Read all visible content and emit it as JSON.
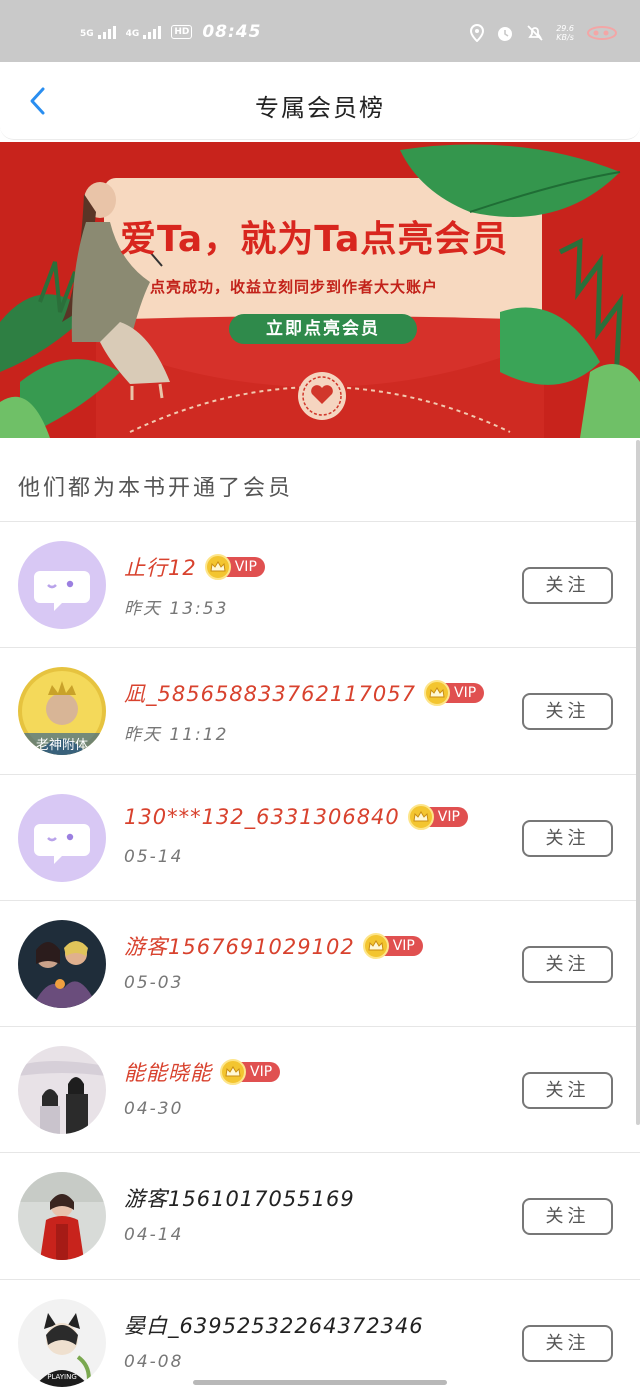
{
  "status_bar": {
    "network1": "5G",
    "network2": "4G",
    "hd": "HD",
    "time": "08:45",
    "speed_value": "29.6",
    "speed_unit": "KB/s"
  },
  "header": {
    "title": "专属会员榜"
  },
  "banner": {
    "headline": "爱Ta，就为Ta点亮会员",
    "subtitle": "点亮成功，收益立刻同步到作者大大账户",
    "cta": "立即点亮会员"
  },
  "section": {
    "heading": "他们都为本书开通了会员"
  },
  "members": [
    {
      "name": "止行12",
      "date": "昨天 13:53",
      "vip": true,
      "avatar": "default-chat-avatar",
      "follow": "关注"
    },
    {
      "name": "凪_5856588337621170​57",
      "date": "昨天 11:12",
      "vip": true,
      "avatar": "photo-avatar-crown",
      "follow": "关注"
    },
    {
      "name": "130***132_6331306840",
      "date": "05-14",
      "vip": true,
      "avatar": "default-chat-avatar",
      "follow": "关注"
    },
    {
      "name": "游客1567691029102",
      "date": "05-03",
      "vip": true,
      "avatar": "photo-avatar-anime-group",
      "follow": "关注"
    },
    {
      "name": "能能晓能",
      "date": "04-30",
      "vip": true,
      "avatar": "photo-avatar-ink-painting",
      "follow": "关注"
    },
    {
      "name": "游客1561017055169",
      "date": "04-14",
      "vip": false,
      "avatar": "photo-avatar-red-coat",
      "follow": "关注"
    },
    {
      "name": "晏白_6395253226437234​6",
      "date": "04-08",
      "vip": false,
      "avatar": "photo-avatar-cat-ears",
      "follow": "关注"
    }
  ],
  "vip_label": "VIP",
  "colors": {
    "vip_name": "#d8422e",
    "banner_red": "#c8231c",
    "cta_green": "#2f8a4b",
    "default_avatar_bg": "#d8c8f4",
    "back_arrow": "#2a8ef0"
  }
}
